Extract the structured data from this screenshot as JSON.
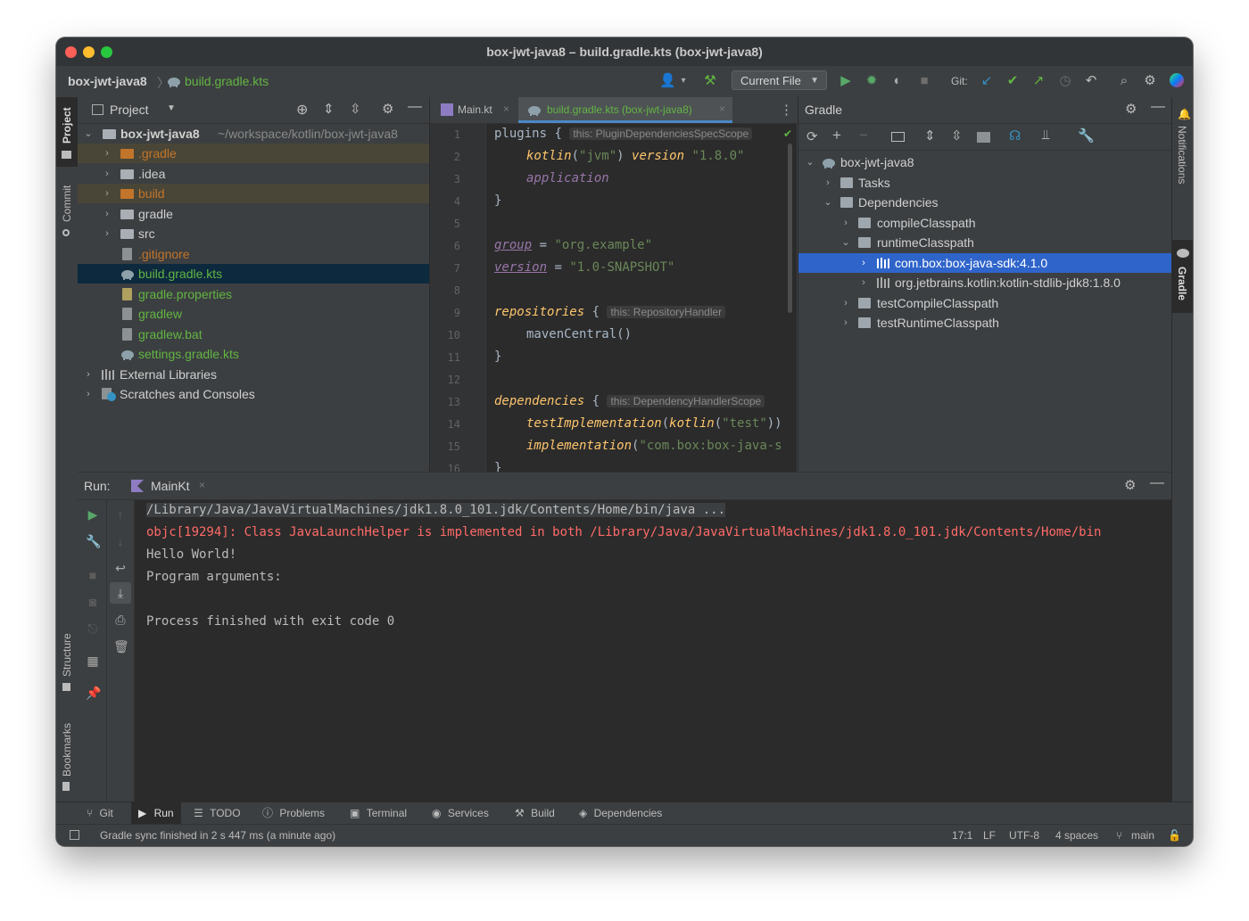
{
  "window": {
    "title": "box-jwt-java8 – build.gradle.kts (box-jwt-java8)"
  },
  "navbar": {
    "crumb_project": "box-jwt-java8",
    "crumb_file": "build.gradle.kts",
    "run_config": "Current File",
    "git_label": "Git:"
  },
  "left_strip": {
    "project": "Project",
    "commit": "Commit",
    "structure": "Structure",
    "bookmarks": "Bookmarks"
  },
  "right_strip": {
    "notifications": "Notifications",
    "gradle": "Gradle"
  },
  "project_panel": {
    "title": "Project",
    "root_name": "box-jwt-java8",
    "root_path": "~/workspace/kotlin/box-jwt-java8",
    "items": [
      {
        "label": ".gradle"
      },
      {
        "label": ".idea"
      },
      {
        "label": "build"
      },
      {
        "label": "gradle"
      },
      {
        "label": "src"
      },
      {
        "label": ".gitignore"
      },
      {
        "label": "build.gradle.kts"
      },
      {
        "label": "gradle.properties"
      },
      {
        "label": "gradlew"
      },
      {
        "label": "gradlew.bat"
      },
      {
        "label": "settings.gradle.kts"
      },
      {
        "label": "External Libraries"
      },
      {
        "label": "Scratches and Consoles"
      }
    ]
  },
  "editor": {
    "tabs": [
      {
        "label": "Main.kt"
      },
      {
        "label": "build.gradle.kts (box-jwt-java8)"
      }
    ],
    "line_numbers": [
      "1",
      "2",
      "3",
      "4",
      "5",
      "6",
      "7",
      "8",
      "9",
      "10",
      "11",
      "12",
      "13",
      "14",
      "15",
      "16"
    ],
    "code": {
      "l1_kw": "plugins",
      "l1_brace": " {",
      "l1_hint": "this: PluginDependenciesSpecScope",
      "l2_fn": "kotlin",
      "l2_arg": "\"jvm\"",
      "l2_kw": "version",
      "l2_ver": "\"1.8.0\"",
      "l3": "application",
      "l4": "}",
      "l6_prop": "group",
      "l6_eq": " = ",
      "l6_val": "\"org.example\"",
      "l7_prop": "version",
      "l7_eq": " = ",
      "l7_val": "\"1.0-SNAPSHOT\"",
      "l9_kw": "repositories",
      "l9_brace": " {",
      "l9_hint": "this: RepositoryHandler",
      "l10": "mavenCentral()",
      "l11": "}",
      "l13_kw": "dependencies",
      "l13_brace": " {",
      "l13_hint": "this: DependencyHandlerScope",
      "l14_fn": "testImplementation",
      "l14_inner": "kotlin",
      "l14_arg": "\"test\"",
      "l14_close": "))",
      "l15_fn": "implementation",
      "l15_arg": "\"com.box:box-java-s",
      "l16": "}"
    }
  },
  "gradle_panel": {
    "title": "Gradle",
    "rows": [
      {
        "label": "box-jwt-java8"
      },
      {
        "label": "Tasks"
      },
      {
        "label": "Dependencies"
      },
      {
        "label": "compileClasspath"
      },
      {
        "label": "runtimeClasspath"
      },
      {
        "label": "com.box:box-java-sdk:4.1.0"
      },
      {
        "label": "org.jetbrains.kotlin:kotlin-stdlib-jdk8:1.8.0"
      },
      {
        "label": "testCompileClasspath"
      },
      {
        "label": "testRuntimeClasspath"
      }
    ]
  },
  "run_panel": {
    "label": "Run:",
    "tab": "MainKt",
    "lines": [
      "/Library/Java/JavaVirtualMachines/jdk1.8.0_101.jdk/Contents/Home/bin/java ...",
      "objc[19294]: Class JavaLaunchHelper is implemented in both /Library/Java/JavaVirtualMachines/jdk1.8.0_101.jdk/Contents/Home/bin",
      "Hello World!",
      "Program arguments:",
      "",
      "Process finished with exit code 0"
    ]
  },
  "bottom_tabs": [
    {
      "label": "Git"
    },
    {
      "label": "Run"
    },
    {
      "label": "TODO"
    },
    {
      "label": "Problems"
    },
    {
      "label": "Terminal"
    },
    {
      "label": "Services"
    },
    {
      "label": "Build"
    },
    {
      "label": "Dependencies"
    }
  ],
  "status_bar": {
    "message": "Gradle sync finished in 2 s 447 ms (a minute ago)",
    "position": "17:1",
    "line_sep": "LF",
    "encoding": "UTF-8",
    "indent": "4 spaces",
    "branch": "main"
  },
  "colors": {
    "selection": "#2f65ca",
    "error_text": "#ff6b68",
    "excluded_folder": "#c2752a",
    "vcs_added_green": "#62b543"
  }
}
